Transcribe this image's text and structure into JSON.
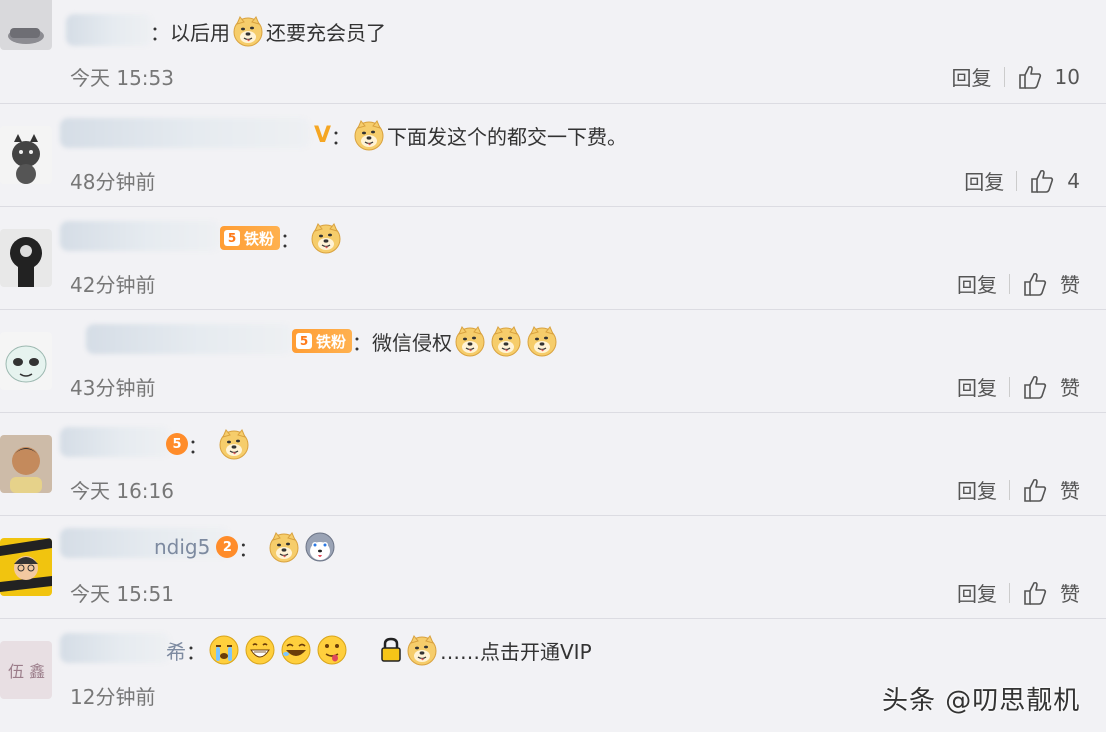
{
  "comments": [
    {
      "text": "以后用",
      "text_after": "还要充会员了",
      "time": "今天 15:53",
      "reply": "回复",
      "likes": "10"
    },
    {
      "text": "下面发这个的都交一下费。",
      "time": "48分钟前",
      "reply": "回复",
      "likes": "4"
    },
    {
      "badge": "铁粉",
      "badge_level": "5",
      "time": "42分钟前",
      "reply": "回复",
      "likes": "赞"
    },
    {
      "badge": "铁粉",
      "badge_level": "5",
      "text": "微信侵权",
      "time": "43分钟前",
      "reply": "回复",
      "likes": "赞"
    },
    {
      "badge_level": "5",
      "time": "今天 16:16",
      "reply": "回复",
      "likes": "赞"
    },
    {
      "username_fragment": "ndig5",
      "badge_level": "2",
      "time": "今天 15:51",
      "reply": "回复",
      "likes": "赞"
    },
    {
      "username_fragment": "希",
      "text": "……点击开通VIP",
      "time": "12分钟前"
    }
  ],
  "colon": "：",
  "watermark": "头条 @叨思靓机"
}
